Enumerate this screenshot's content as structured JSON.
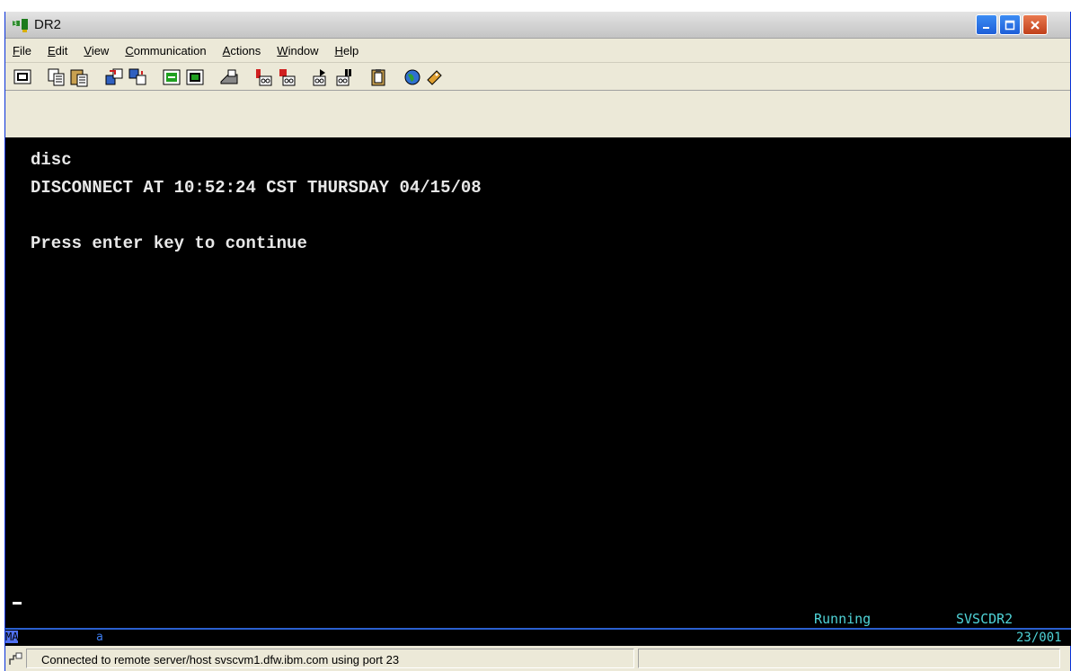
{
  "window": {
    "title": "DR2"
  },
  "menu": [
    {
      "label": "File",
      "u": "F",
      "rest": "ile"
    },
    {
      "label": "Edit",
      "u": "E",
      "rest": "dit"
    },
    {
      "label": "View",
      "u": "V",
      "rest": "iew"
    },
    {
      "label": "Communication",
      "u": "C",
      "rest": "ommunication"
    },
    {
      "label": "Actions",
      "u": "A",
      "rest": "ctions"
    },
    {
      "label": "Window",
      "u": "W",
      "rest": "indow"
    },
    {
      "label": "Help",
      "u": "H",
      "rest": "elp"
    }
  ],
  "toolbar_icons": [
    "display-setup-icon",
    "copy-icon",
    "paste-icon",
    "send-file-icon",
    "receive-file-icon",
    "keyboard-map-icon",
    "color-map-icon",
    "print-screen-icon",
    "macro-record-icon",
    "macro-stop-icon",
    "macro-play-icon",
    "macro-pause-icon",
    "clipboard-icon",
    "globe-icon",
    "help-tag-icon"
  ],
  "terminal": {
    "lines": [
      "disc",
      "DISCONNECT AT 10:52:24 CST THURSDAY 04/15/08",
      "",
      "Press enter key to continue"
    ],
    "status_running": "Running",
    "status_host": "SVSCDR2"
  },
  "oia": {
    "ma": "MA",
    "indicator": "a",
    "cursor_pos": "23/001"
  },
  "statusbar": {
    "message": "Connected to remote server/host svscvm1.dfw.ibm.com using port 23"
  },
  "colors": {
    "terminal_bg": "#000000",
    "terminal_text": "#e8e8e8",
    "status_cyan": "#4fd4d8",
    "oia_blue": "#3c7cf0"
  }
}
